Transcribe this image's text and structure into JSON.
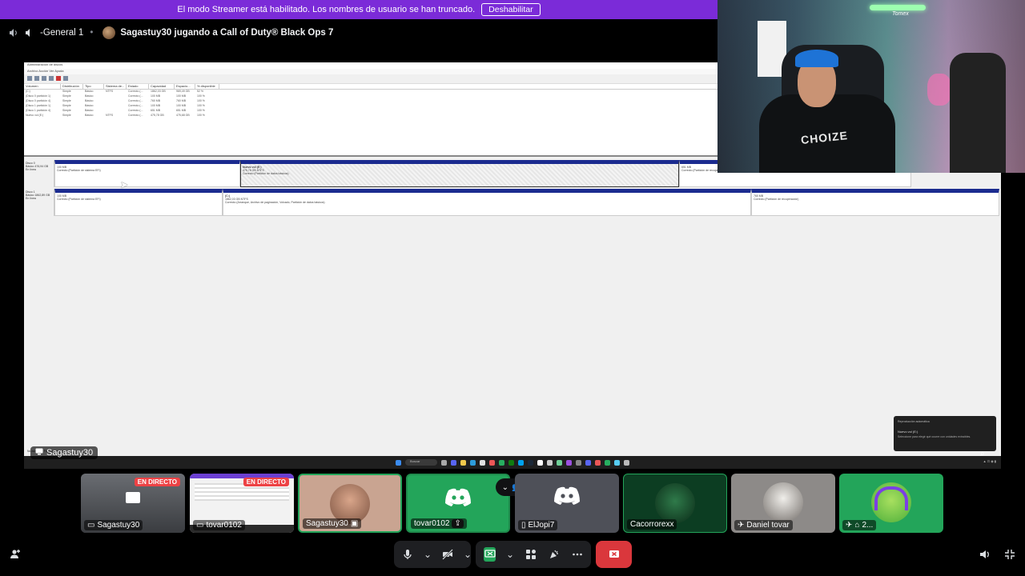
{
  "banner": {
    "text": "El modo Streamer está habilitado. Los nombres de usuario se han truncado.",
    "button": "Deshabilitar"
  },
  "header": {
    "channel": "-General 1",
    "activity": "Sagastuy30 jugando a Call of Duty® Black Ops 7"
  },
  "stream": {
    "owner": "Sagastuy30",
    "window_title": "Administración de discos",
    "menu": "Archivo   Acción   Ver   Ayuda",
    "columns": [
      "Volumen",
      "Distribución",
      "Tipo",
      "Sistema de...",
      "Estado",
      "Capacidad",
      "Espacio...",
      "% disponible"
    ],
    "rows": [
      [
        "(C:)",
        "Simple",
        "Básico",
        "NTFS",
        "Correcto (...",
        "1862,03 GB",
        "969,49 GB",
        "52 %"
      ],
      [
        "(Disco 0 partición 1)",
        "Simple",
        "Básico",
        "",
        "Correcto (...",
        "100 MB",
        "100 MB",
        "100 %"
      ],
      [
        "(Disco 0 partición 4)",
        "Simple",
        "Básico",
        "",
        "Correcto (...",
        "760 MB",
        "760 MB",
        "100 %"
      ],
      [
        "(Disco 1 partición 1)",
        "Simple",
        "Básico",
        "",
        "Correcto (...",
        "100 MB",
        "100 MB",
        "100 %"
      ],
      [
        "(Disco 1 partición 4)",
        "Simple",
        "Básico",
        "",
        "Correcto (...",
        "651 MB",
        "651 MB",
        "100 %"
      ],
      [
        "Nuevo vol (E:)",
        "Simple",
        "Básico",
        "NTFS",
        "Correcto (...",
        "475,78 GB",
        "475,68 GB",
        "100 %"
      ]
    ],
    "disk0": {
      "label": "Disco 0",
      "info": "Básico 476,94 GB En línea",
      "p1": "100 MB",
      "p1_status": "Correcto (Partición de sistema EFI)",
      "p2": "Nuevo vol (E:)",
      "p2_size": "475,78 GB NTFS",
      "p2_status": "Correcto (Partición de datos básicos)",
      "p3": "651 MB",
      "p3_status": "Correcto (Partición de recuperación)"
    },
    "disk1": {
      "label": "Disco 1",
      "info": "Básico 1862,89 GB En línea",
      "p1": "100 MB",
      "p1_status": "Correcto (Partición de sistema EFI)",
      "p2": "(C:)",
      "p2_size": "1862,03 GB NTFS",
      "p2_status": "Correcto (Arranque, Archivo de paginación, Volcado, Partición de datos básicos)",
      "p3": "760 MB",
      "p3_status": "Correcto (Partición de recuperación)"
    },
    "legend": "No asignado   Partición primaria",
    "taskbar_search": "Buscar",
    "toast_title": "Reproducción automática",
    "toast_body": "Nuevo vol (E:)",
    "toast_sub": "Seleccione para elegir qué ocurre con unidades extraíbles."
  },
  "webcam": {
    "shirt_text": "CHOIZE",
    "sign_text": "Tomex"
  },
  "tiles": [
    {
      "name": "Sagastuy30",
      "live": "EN DIRECTO",
      "kind": "screen"
    },
    {
      "name": "tovar0102",
      "live": "EN DIRECTO",
      "kind": "screen"
    },
    {
      "name": "Sagastuy30",
      "kind": "camera"
    },
    {
      "name": "tovar0102",
      "kind": "discord"
    },
    {
      "name": "ElJopi7",
      "kind": "discord"
    },
    {
      "name": "Cacorrorexx",
      "kind": "avatar"
    },
    {
      "name": "Daniel tovar",
      "kind": "avatar"
    },
    {
      "name": "2...",
      "kind": "avatar"
    }
  ],
  "colors": {
    "banner": "#7b2bd8",
    "discord_green": "#23a55a",
    "live_red": "#ed4245",
    "hangup": "#da373c"
  }
}
